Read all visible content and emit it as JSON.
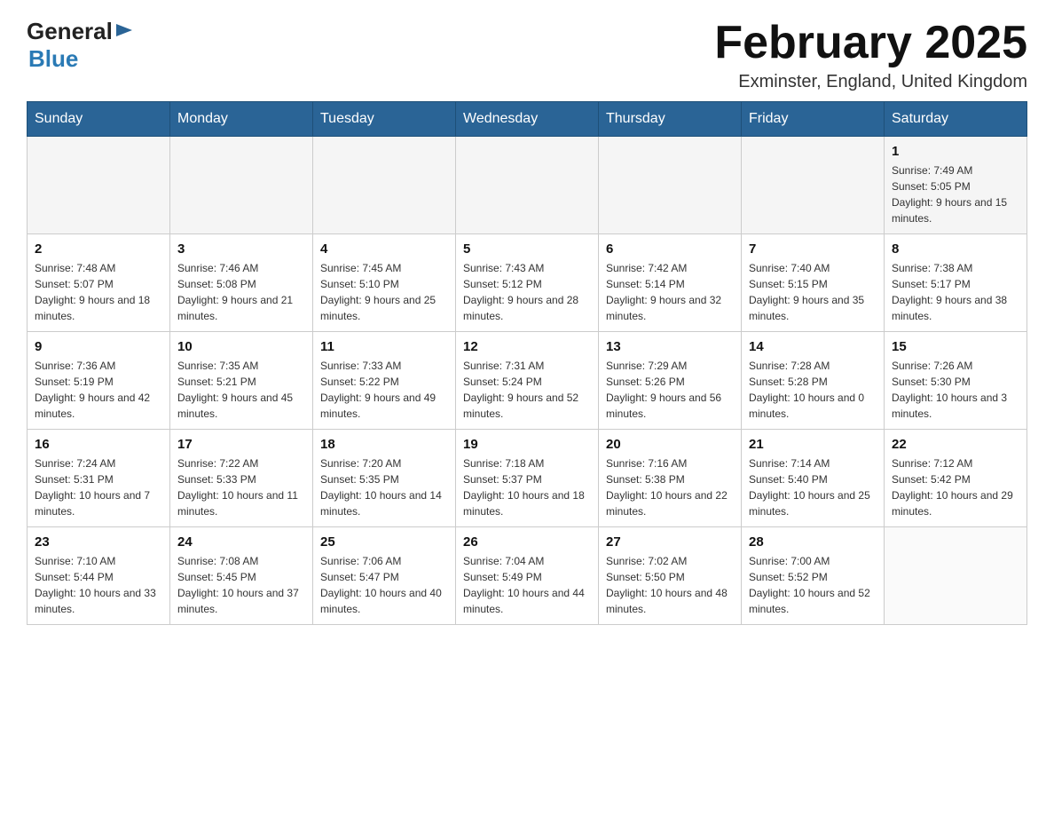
{
  "header": {
    "logo_general": "General",
    "logo_blue": "Blue",
    "month_title": "February 2025",
    "location": "Exminster, England, United Kingdom"
  },
  "weekdays": [
    "Sunday",
    "Monday",
    "Tuesday",
    "Wednesday",
    "Thursday",
    "Friday",
    "Saturday"
  ],
  "weeks": [
    [
      {
        "day": "",
        "info": ""
      },
      {
        "day": "",
        "info": ""
      },
      {
        "day": "",
        "info": ""
      },
      {
        "day": "",
        "info": ""
      },
      {
        "day": "",
        "info": ""
      },
      {
        "day": "",
        "info": ""
      },
      {
        "day": "1",
        "info": "Sunrise: 7:49 AM\nSunset: 5:05 PM\nDaylight: 9 hours and 15 minutes."
      }
    ],
    [
      {
        "day": "2",
        "info": "Sunrise: 7:48 AM\nSunset: 5:07 PM\nDaylight: 9 hours and 18 minutes."
      },
      {
        "day": "3",
        "info": "Sunrise: 7:46 AM\nSunset: 5:08 PM\nDaylight: 9 hours and 21 minutes."
      },
      {
        "day": "4",
        "info": "Sunrise: 7:45 AM\nSunset: 5:10 PM\nDaylight: 9 hours and 25 minutes."
      },
      {
        "day": "5",
        "info": "Sunrise: 7:43 AM\nSunset: 5:12 PM\nDaylight: 9 hours and 28 minutes."
      },
      {
        "day": "6",
        "info": "Sunrise: 7:42 AM\nSunset: 5:14 PM\nDaylight: 9 hours and 32 minutes."
      },
      {
        "day": "7",
        "info": "Sunrise: 7:40 AM\nSunset: 5:15 PM\nDaylight: 9 hours and 35 minutes."
      },
      {
        "day": "8",
        "info": "Sunrise: 7:38 AM\nSunset: 5:17 PM\nDaylight: 9 hours and 38 minutes."
      }
    ],
    [
      {
        "day": "9",
        "info": "Sunrise: 7:36 AM\nSunset: 5:19 PM\nDaylight: 9 hours and 42 minutes."
      },
      {
        "day": "10",
        "info": "Sunrise: 7:35 AM\nSunset: 5:21 PM\nDaylight: 9 hours and 45 minutes."
      },
      {
        "day": "11",
        "info": "Sunrise: 7:33 AM\nSunset: 5:22 PM\nDaylight: 9 hours and 49 minutes."
      },
      {
        "day": "12",
        "info": "Sunrise: 7:31 AM\nSunset: 5:24 PM\nDaylight: 9 hours and 52 minutes."
      },
      {
        "day": "13",
        "info": "Sunrise: 7:29 AM\nSunset: 5:26 PM\nDaylight: 9 hours and 56 minutes."
      },
      {
        "day": "14",
        "info": "Sunrise: 7:28 AM\nSunset: 5:28 PM\nDaylight: 10 hours and 0 minutes."
      },
      {
        "day": "15",
        "info": "Sunrise: 7:26 AM\nSunset: 5:30 PM\nDaylight: 10 hours and 3 minutes."
      }
    ],
    [
      {
        "day": "16",
        "info": "Sunrise: 7:24 AM\nSunset: 5:31 PM\nDaylight: 10 hours and 7 minutes."
      },
      {
        "day": "17",
        "info": "Sunrise: 7:22 AM\nSunset: 5:33 PM\nDaylight: 10 hours and 11 minutes."
      },
      {
        "day": "18",
        "info": "Sunrise: 7:20 AM\nSunset: 5:35 PM\nDaylight: 10 hours and 14 minutes."
      },
      {
        "day": "19",
        "info": "Sunrise: 7:18 AM\nSunset: 5:37 PM\nDaylight: 10 hours and 18 minutes."
      },
      {
        "day": "20",
        "info": "Sunrise: 7:16 AM\nSunset: 5:38 PM\nDaylight: 10 hours and 22 minutes."
      },
      {
        "day": "21",
        "info": "Sunrise: 7:14 AM\nSunset: 5:40 PM\nDaylight: 10 hours and 25 minutes."
      },
      {
        "day": "22",
        "info": "Sunrise: 7:12 AM\nSunset: 5:42 PM\nDaylight: 10 hours and 29 minutes."
      }
    ],
    [
      {
        "day": "23",
        "info": "Sunrise: 7:10 AM\nSunset: 5:44 PM\nDaylight: 10 hours and 33 minutes."
      },
      {
        "day": "24",
        "info": "Sunrise: 7:08 AM\nSunset: 5:45 PM\nDaylight: 10 hours and 37 minutes."
      },
      {
        "day": "25",
        "info": "Sunrise: 7:06 AM\nSunset: 5:47 PM\nDaylight: 10 hours and 40 minutes."
      },
      {
        "day": "26",
        "info": "Sunrise: 7:04 AM\nSunset: 5:49 PM\nDaylight: 10 hours and 44 minutes."
      },
      {
        "day": "27",
        "info": "Sunrise: 7:02 AM\nSunset: 5:50 PM\nDaylight: 10 hours and 48 minutes."
      },
      {
        "day": "28",
        "info": "Sunrise: 7:00 AM\nSunset: 5:52 PM\nDaylight: 10 hours and 52 minutes."
      },
      {
        "day": "",
        "info": ""
      }
    ]
  ]
}
